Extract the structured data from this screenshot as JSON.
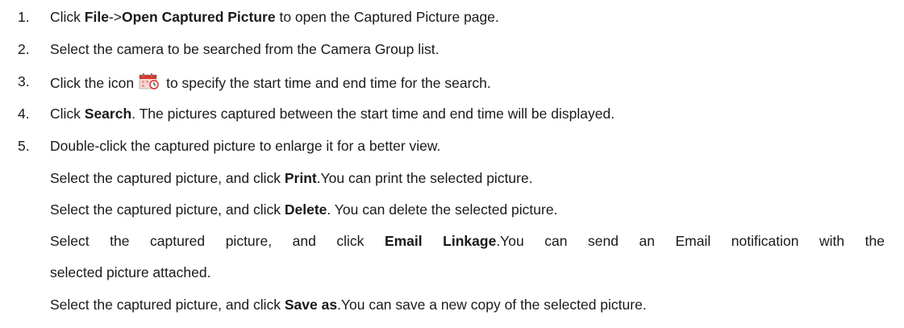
{
  "steps": [
    {
      "num": "1.",
      "pre": "Click ",
      "b1": "File",
      "mid": "->",
      "b2": "Open Captured Picture",
      "post": " to open the Captured Picture page."
    },
    {
      "num": "2.",
      "text": "Select the camera to be searched from the Camera Group list."
    },
    {
      "num": "3.",
      "pre": "Click the icon",
      "post": "to specify the start time and end time for the search."
    },
    {
      "num": "4.",
      "pre": "Click ",
      "b": "Search",
      "post": ". The pictures captured between the start time and end time will be displayed."
    },
    {
      "num": "5.",
      "text": "Double-click the captured picture to enlarge it for a better view."
    }
  ],
  "subs": [
    {
      "pre": "Select the captured picture, and click ",
      "b": "Print",
      "post": ".You can print the selected picture."
    },
    {
      "pre": "Select the captured picture, and click ",
      "b": "Delete",
      "post": ". You can delete the selected picture."
    },
    {
      "pre": "Select the captured picture, and click ",
      "b": "Email Linkage",
      "post": ".You can send an Email notification with the",
      "cont": "selected picture attached."
    },
    {
      "pre": "Select the captured picture, and click ",
      "b": "Save as",
      "post": ".You can save a new copy of the selected picture."
    }
  ],
  "icons": {
    "calendar": "calendar-icon"
  },
  "colors": {
    "text": "#1a1a1a",
    "icon_red": "#d9342b"
  }
}
